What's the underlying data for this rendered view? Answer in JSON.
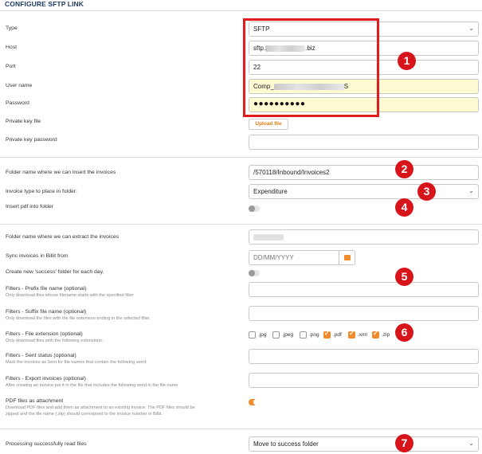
{
  "header": {
    "title": "CONFIGURE SFTP LINK"
  },
  "section1": {
    "type": {
      "label": "Type",
      "value": "SFTP"
    },
    "host": {
      "label": "Host",
      "value_prefix": "sftp.",
      "value_suffix": ".biz"
    },
    "port": {
      "label": "Port",
      "value": "22"
    },
    "username": {
      "label": "User name",
      "value_prefix": "Comp_",
      "value_suffix": "S"
    },
    "password": {
      "label": "Password",
      "value": "●●●●●●●●●●"
    },
    "private_key_file": {
      "label": "Private key file",
      "button": "Upload file"
    },
    "private_key_password": {
      "label": "Private key password",
      "value": ""
    }
  },
  "section2": {
    "insert_folder": {
      "label": "Folder name where we can insert the invoices",
      "value": "/570118/Inbound/Invoices2"
    },
    "invoice_type": {
      "label": "Invoice type to place in folder:",
      "value": "Expenditure"
    },
    "insert_pdf": {
      "label": "Insert pdf into folder",
      "enabled": false
    }
  },
  "section3": {
    "extract_folder": {
      "label": "Folder name where we can extract the invoices"
    },
    "sync_from": {
      "label": "Sync invoices in Billit from",
      "placeholder": "DD/MM/YYYY"
    },
    "success_folder": {
      "label": "Create new 'success' folder for each day.",
      "enabled": false
    },
    "prefix": {
      "label": "Filters - Prefix file name (optional)",
      "desc": "Only download files whose filename starts with the specified filter",
      "value": ""
    },
    "suffix": {
      "label": "Filters - Suffix file name (optional)",
      "desc": "Only download the files with the file extension ending in the selected filter",
      "value": ""
    },
    "extension": {
      "label": "Filters - File extension (optional)",
      "desc": "Only download files with the following extensions:",
      "options": [
        {
          "label": ".jpg",
          "checked": false
        },
        {
          "label": ".jpeg",
          "checked": false
        },
        {
          "label": ".png",
          "checked": false
        },
        {
          "label": ".pdf",
          "checked": true
        },
        {
          "label": ".xml",
          "checked": true
        },
        {
          "label": ".zip",
          "checked": true
        }
      ]
    },
    "sent_status": {
      "label": "Filters - Sent status (optional)",
      "desc": "Mark the invoices as Sent for file names that contain the following word:",
      "value": ""
    },
    "export": {
      "label": "Filters - Export invoices (optional)",
      "desc": "After creating an invoice put it in the file that includes the following word in the file name",
      "value": ""
    },
    "pdf_attachment": {
      "label": "PDF files as attachment",
      "desc1": "Download PDF files and add them as attachment to an existing invoice. The PDF files should be",
      "desc2": "zipped and the file name (.zip) should correspond to the invoice number in Billit.",
      "enabled": true
    }
  },
  "section4": {
    "processing": {
      "label": "Processing successfully read files",
      "value": "Move to success folder"
    }
  },
  "annotations": [
    "1",
    "2",
    "3",
    "4",
    "5",
    "6",
    "7"
  ],
  "colors": {
    "accent": "#f08a2a",
    "annotation_red": "#d8141b",
    "title_blue": "#1e3a5f",
    "highlight": "#fefbd3"
  }
}
